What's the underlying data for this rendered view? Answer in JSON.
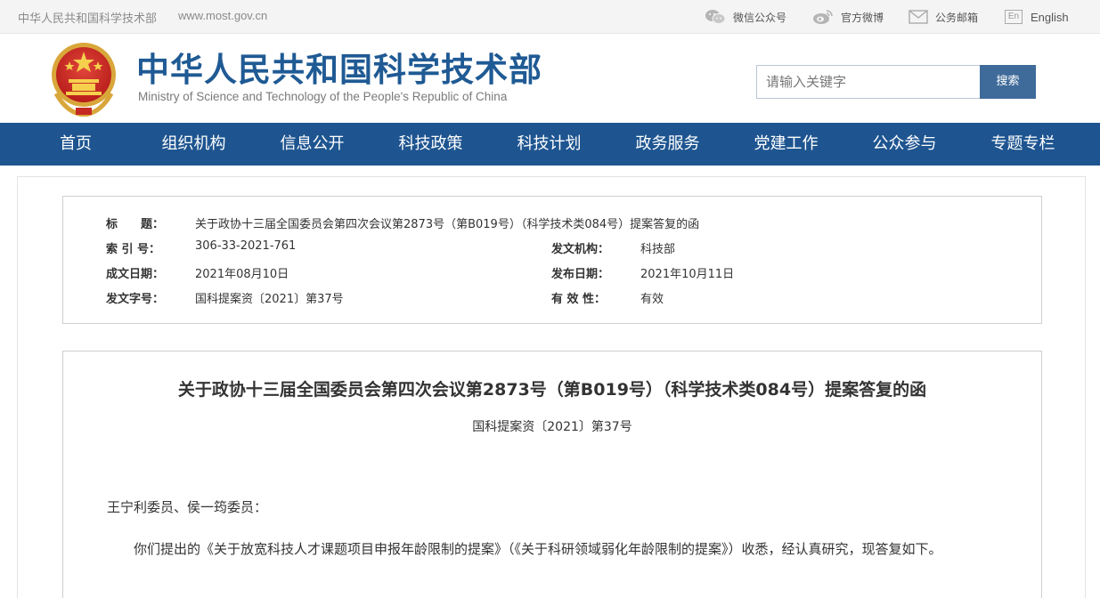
{
  "topbar": {
    "site_name": "中华人民共和国科学技术部",
    "site_url": "www.most.gov.cn",
    "links": {
      "wechat": "微信公众号",
      "weibo": "官方微博",
      "mail": "公务邮箱",
      "english_badge": "En",
      "english": "English"
    }
  },
  "header": {
    "cn_title": "中华人民共和国科学技术部",
    "en_title": "Ministry of Science and Technology of the People's Republic of China",
    "search": {
      "placeholder": "请输入关键字",
      "button": "搜索"
    }
  },
  "nav": {
    "items": [
      "首页",
      "组织机构",
      "信息公开",
      "科技政策",
      "科技计划",
      "政务服务",
      "党建工作",
      "公众参与",
      "专题专栏"
    ]
  },
  "meta": {
    "title_label": "标　　题：",
    "title_value": "关于政协十三届全国委员会第四次会议第2873号（第B019号）（科学技术类084号）提案答复的函",
    "index_label": "索 引 号：",
    "index_value": "306-33-2021-761",
    "org_label": "发文机构：",
    "org_value": "科技部",
    "created_label": "成文日期：",
    "created_value": "2021年08月10日",
    "published_label": "发布日期：",
    "published_value": "2021年10月11日",
    "docno_label": "发文字号：",
    "docno_value": "国科提案资〔2021〕第37号",
    "validity_label": "有 效 性：",
    "validity_value": "有效"
  },
  "article": {
    "title": "关于政协十三届全国委员会第四次会议第2873号（第B019号）（科学技术类084号）提案答复的函",
    "docno": "国科提案资〔2021〕第37号",
    "salutation": "王宁利委员、侯一筠委员：",
    "paragraph": "你们提出的《关于放宽科技人才课题项目申报年龄限制的提案》（《关于科研领域弱化年龄限制的提案》）收悉，经认真研究，现答复如下。"
  },
  "colors": {
    "brand_blue": "#1f5a94",
    "nav_bg": "#1e5590",
    "search_button": "#3f6b9a"
  }
}
